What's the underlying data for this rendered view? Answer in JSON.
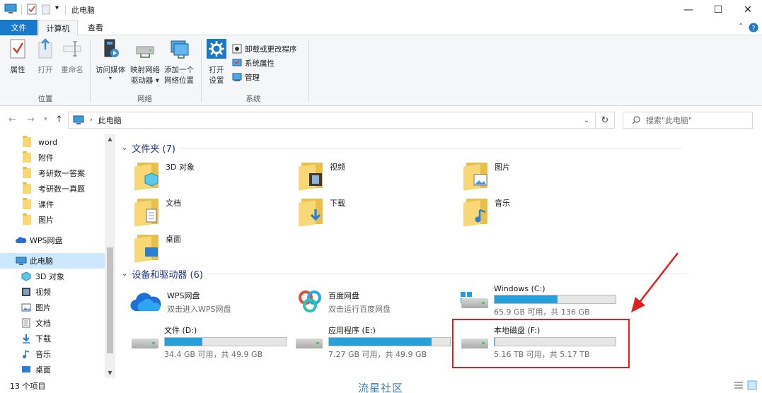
{
  "window": {
    "title": "此电脑",
    "minimize": "—",
    "maximize": "☐",
    "close": "✕"
  },
  "tabs": {
    "file": "文件",
    "computer": "计算机",
    "view": "查看"
  },
  "ribbon": {
    "location_group": "位置",
    "network_group": "网络",
    "system_group": "系统",
    "properties": "属性",
    "open": "打开",
    "rename": "重命名",
    "access_media": "访问媒体",
    "map_drive_1": "映射网络",
    "map_drive_2": "驱动器 ▾",
    "add_location_1": "添加一个",
    "add_location_2": "网络位置",
    "open_settings_1": "打开",
    "open_settings_2": "设置",
    "uninstall": "卸载或更改程序",
    "system_props": "系统属性",
    "manage": "管理"
  },
  "nav": {
    "breadcrumb": "此电脑",
    "search_placeholder": "搜索\"此电脑\""
  },
  "sidebar": {
    "items": [
      "word",
      "附件",
      "考研数一答案",
      "考研数一真题",
      "课件",
      "图片"
    ],
    "wps": "WPS网盘",
    "this_pc": "此电脑",
    "sub": [
      "3D 对象",
      "视频",
      "图片",
      "文档",
      "下载",
      "音乐",
      "桌面"
    ]
  },
  "folders": {
    "header": "文件夹 (7)",
    "items": [
      "3D 对象",
      "视频",
      "图片",
      "文档",
      "下载",
      "音乐",
      "桌面"
    ]
  },
  "devices": {
    "header": "设备和驱动器 (6)",
    "wps_name": "WPS网盘",
    "wps_sub": "双击进入WPS网盘",
    "baidu_name": "百度网盘",
    "baidu_sub": "双击运行百度网盘",
    "drives": [
      {
        "name": "Windows (C:)",
        "info": "65.9 GB 可用，共 136 GB",
        "used_fraction": 0.52
      },
      {
        "name": "文件 (D:)",
        "info": "34.4 GB 可用，共 49.9 GB",
        "used_fraction": 0.31
      },
      {
        "name": "应用程序 (E:)",
        "info": "7.27 GB 可用，共 49.9 GB",
        "used_fraction": 0.85
      },
      {
        "name": "本地磁盘 (F:)",
        "info": "5.16 TB 可用，共 5.17 TB",
        "used_fraction": 0.002
      }
    ]
  },
  "status": {
    "count": "13 个项目"
  },
  "watermark": "流星社区"
}
